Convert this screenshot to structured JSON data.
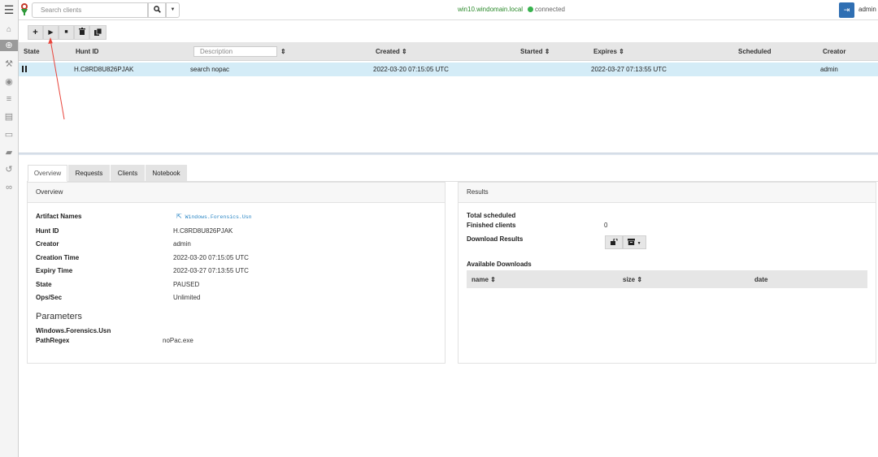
{
  "topbar": {
    "search_placeholder": "Search clients",
    "search_icon": "search-icon",
    "dropdown_icon": "caret-down-icon",
    "hostname": "win10.windomain.local",
    "status": "connected",
    "logout_icon": "sign-out-icon",
    "username": "admin"
  },
  "sidebar": {
    "items": [
      {
        "icon": "menu-icon",
        "glyph": "☰"
      },
      {
        "icon": "logo-icon",
        "glyph": ""
      },
      {
        "icon": "home-icon",
        "glyph": "⌂"
      },
      {
        "icon": "crosshairs-icon",
        "glyph": "⊕"
      },
      {
        "icon": "wrench-icon",
        "glyph": "⚒"
      },
      {
        "icon": "eye-icon",
        "glyph": "◉"
      },
      {
        "icon": "server-icon",
        "glyph": "≡"
      },
      {
        "icon": "book-icon",
        "glyph": "▤"
      },
      {
        "icon": "laptop-icon",
        "glyph": "▭"
      },
      {
        "icon": "folder-icon",
        "glyph": "▰"
      },
      {
        "icon": "history-icon",
        "glyph": "↺"
      },
      {
        "icon": "binoculars-icon",
        "glyph": "∞"
      }
    ]
  },
  "toolbar": {
    "new_hunt": "+",
    "run": "▶",
    "stop": "■",
    "delete": "🗑",
    "copy": "❐"
  },
  "hunts_table": {
    "columns": {
      "state": "State",
      "hunt_id": "Hunt ID",
      "description_placeholder": "Description",
      "created": "Created",
      "started": "Started",
      "expires": "Expires",
      "scheduled": "Scheduled",
      "creator": "Creator",
      "sort_icon": "⇕"
    },
    "rows": [
      {
        "state": "paused",
        "hunt_id": "H.C8RD8U826PJAK",
        "description": "search nopac",
        "created": "2022-03-20 07:15:05 UTC",
        "started": "",
        "expires": "2022-03-27 07:13:55 UTC",
        "scheduled": "",
        "creator": "admin"
      }
    ]
  },
  "tabs": [
    "Overview",
    "Requests",
    "Clients",
    "Notebook"
  ],
  "overview": {
    "title": "Overview",
    "fields": [
      {
        "key": "Artifact Names",
        "value": "Windows.Forensics.Usn",
        "link": true
      },
      {
        "key": "Hunt ID",
        "value": "H.C8RD8U826PJAK"
      },
      {
        "key": "Creator",
        "value": "admin"
      },
      {
        "key": "Creation Time",
        "value": "2022-03-20 07:15:05 UTC"
      },
      {
        "key": "Expiry Time",
        "value": "2022-03-27 07:13:55 UTC"
      },
      {
        "key": "State",
        "value": "PAUSED"
      },
      {
        "key": "Ops/Sec",
        "value": "Unlimited"
      }
    ],
    "parameters_title": "Parameters",
    "artifact": "Windows.Forensics.Usn",
    "param_key": "PathRegex",
    "param_value": "noPac.exe"
  },
  "results": {
    "title": "Results",
    "total_scheduled_label": "Total scheduled",
    "finished_label": "Finished clients",
    "finished_value": "0",
    "download_results_label": "Download Results",
    "available_downloads_label": "Available Downloads",
    "columns": {
      "name": "name",
      "size": "size",
      "date": "date"
    }
  },
  "annotation": {
    "color": "#e8453c"
  }
}
